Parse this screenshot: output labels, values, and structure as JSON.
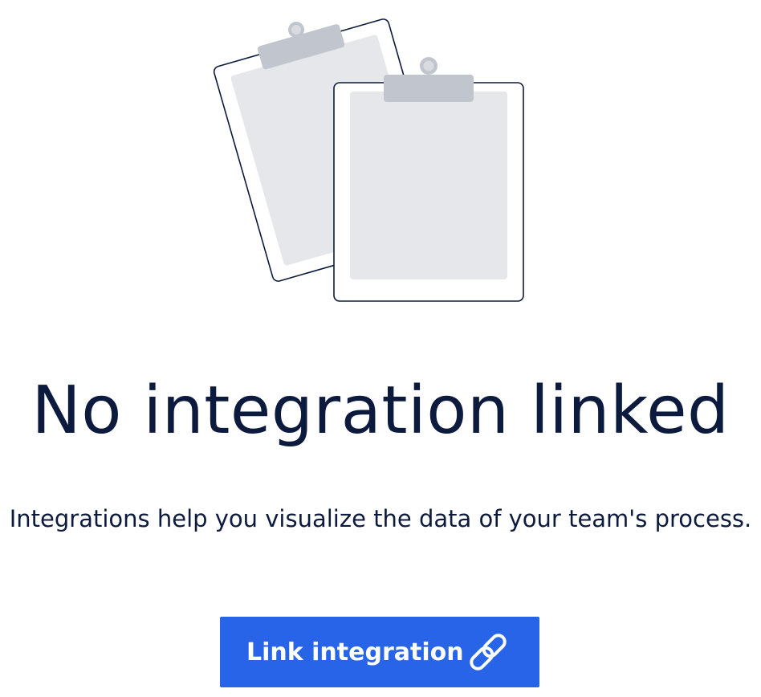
{
  "empty_state": {
    "illustration_icon": "clipboards-icon",
    "title": "No integration linked",
    "description": "Integrations help you visualize the data of your team's process.",
    "button": {
      "label": "Link integration",
      "icon": "link-icon"
    }
  },
  "colors": {
    "title_text": "#0b1a3d",
    "button_bg": "#2764e8",
    "button_text": "#ffffff",
    "clip": "#c1c5cd",
    "paper": "#e6e7ea"
  }
}
